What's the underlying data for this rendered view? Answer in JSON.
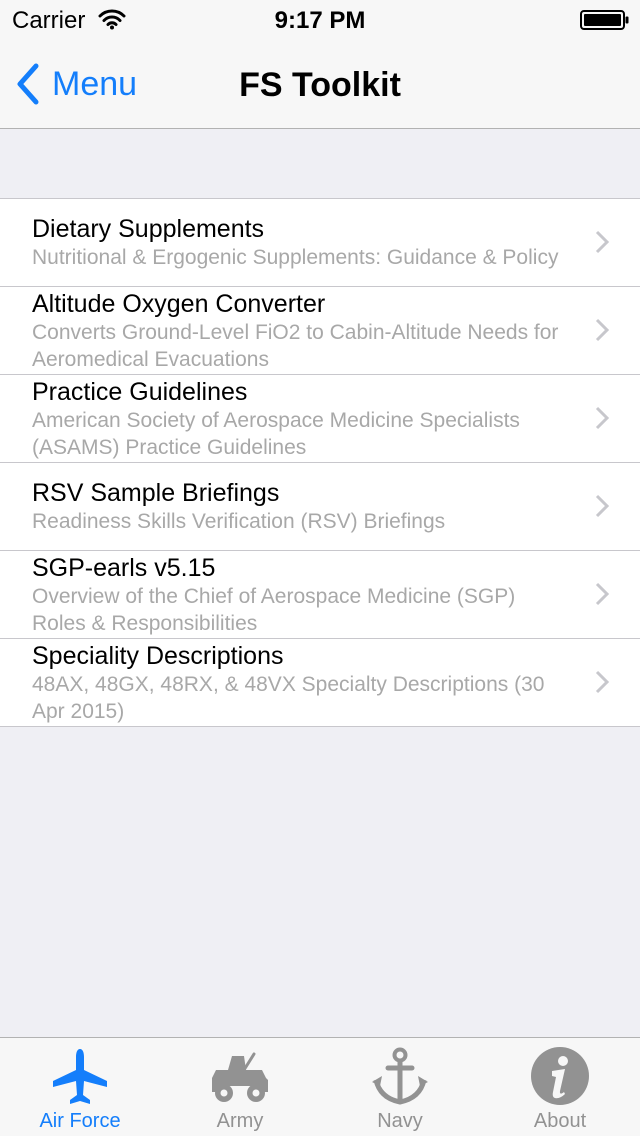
{
  "status_bar": {
    "carrier": "Carrier",
    "time": "9:17 PM"
  },
  "nav": {
    "back_label": "Menu",
    "title": "FS Toolkit"
  },
  "items": [
    {
      "title": "Dietary Supplements",
      "subtitle": "Nutritional & Ergogenic Supplements: Guidance & Policy"
    },
    {
      "title": "Altitude Oxygen Converter",
      "subtitle": "Converts Ground-Level FiO2 to Cabin-Altitude Needs for Aeromedical Evacuations"
    },
    {
      "title": "Practice Guidelines",
      "subtitle": "American Society of Aerospace Medicine Specialists (ASAMS) Practice Guidelines"
    },
    {
      "title": "RSV Sample Briefings",
      "subtitle": "Readiness Skills Verification (RSV) Briefings"
    },
    {
      "title": "SGP-earls v5.15",
      "subtitle": "Overview of the Chief of Aerospace Medicine (SGP) Roles & Responsibilities"
    },
    {
      "title": "Speciality Descriptions",
      "subtitle": "48AX, 48GX, 48RX, & 48VX Specialty Descriptions (30 Apr 2015)"
    }
  ],
  "tabs": [
    {
      "label": "Air Force",
      "icon": "airplane-icon",
      "selected": true
    },
    {
      "label": "Army",
      "icon": "jeep-icon",
      "selected": false
    },
    {
      "label": "Navy",
      "icon": "anchor-icon",
      "selected": false
    },
    {
      "label": "About",
      "icon": "info-icon",
      "selected": false
    }
  ],
  "colors": {
    "accent": "#147efb",
    "inactive": "#929292",
    "subtitle": "#a8a8a8",
    "background": "#efeff4"
  }
}
